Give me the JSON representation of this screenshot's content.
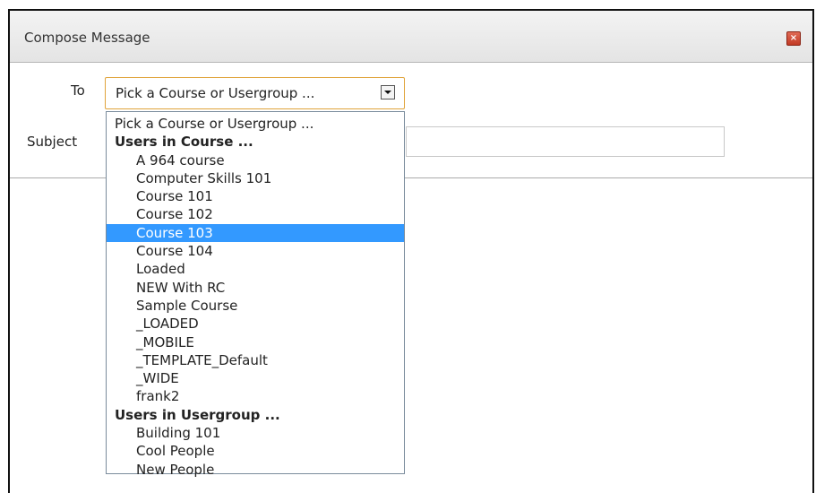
{
  "dialog": {
    "title": "Compose Message",
    "close_label": "×"
  },
  "form": {
    "to_label": "To",
    "subject_label": "Subject",
    "to_value": "Pick a Course or Usergroup ...",
    "subject_value": ""
  },
  "dropdown": {
    "options": [
      {
        "label": "Pick a Course or Usergroup ...",
        "kind": "placeholder"
      },
      {
        "label": "Users in Course ...",
        "kind": "group"
      },
      {
        "label": "A 964 course",
        "kind": "child"
      },
      {
        "label": "Computer Skills 101",
        "kind": "child"
      },
      {
        "label": "Course 101",
        "kind": "child"
      },
      {
        "label": "Course 102",
        "kind": "child"
      },
      {
        "label": "Course 103",
        "kind": "child",
        "selected": true
      },
      {
        "label": "Course 104",
        "kind": "child"
      },
      {
        "label": "Loaded",
        "kind": "child"
      },
      {
        "label": "NEW With RC",
        "kind": "child"
      },
      {
        "label": "Sample Course",
        "kind": "child"
      },
      {
        "label": "_LOADED",
        "kind": "child"
      },
      {
        "label": "_MOBILE",
        "kind": "child"
      },
      {
        "label": "_TEMPLATE_Default",
        "kind": "child"
      },
      {
        "label": "_WIDE",
        "kind": "child"
      },
      {
        "label": "frank2",
        "kind": "child"
      },
      {
        "label": "Users in Usergroup ...",
        "kind": "group"
      },
      {
        "label": "Building 101",
        "kind": "child"
      },
      {
        "label": "Cool People",
        "kind": "child"
      },
      {
        "label": "New People",
        "kind": "child"
      }
    ]
  },
  "colors": {
    "highlight": "#3399ff",
    "focus_border": "#e0a33a",
    "close_button": "#c23a25"
  }
}
